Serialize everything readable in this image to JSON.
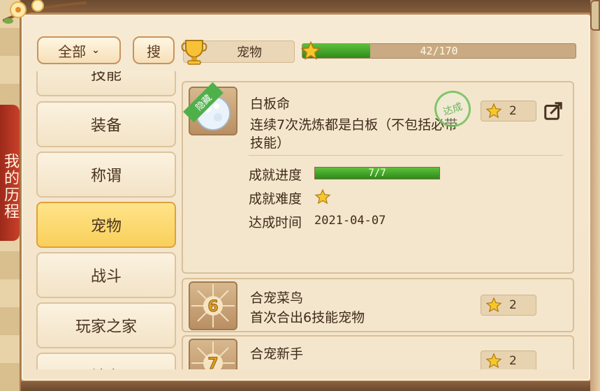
{
  "side_tab": {
    "label": "我的历程"
  },
  "toolbar": {
    "filter_label": "全部",
    "search_label": "搜",
    "category_label": "宠物",
    "progress": {
      "current": 42,
      "total": 170,
      "text": "42/170",
      "fraction": 0.247
    }
  },
  "categories": [
    {
      "label": "技能",
      "active": false
    },
    {
      "label": "装备",
      "active": false
    },
    {
      "label": "称谓",
      "active": false
    },
    {
      "label": "宠物",
      "active": true
    },
    {
      "label": "战斗",
      "active": false
    },
    {
      "label": "玩家之家",
      "active": false
    },
    {
      "label": "社交",
      "active": false
    }
  ],
  "achievements": [
    {
      "ribbon": "隐藏",
      "name": "白板命",
      "desc_line1": "连续7次洗炼都是白板（不包括必带",
      "desc_line2": "技能）",
      "points": "2",
      "stamp": "达成",
      "details": {
        "progress_label": "成就进度",
        "progress_text": "7/7",
        "progress_fraction": 1.0,
        "difficulty_label": "成就难度",
        "difficulty_stars": 1,
        "time_label": "达成时间",
        "time_value": "2021-04-07"
      }
    },
    {
      "icon_num": "6",
      "name": "合宠菜鸟",
      "desc": "首次合出6技能宠物",
      "points": "2"
    },
    {
      "icon_num": "7",
      "name": "合宠新手",
      "points": "2"
    }
  ],
  "colors": {
    "accent_gold": "#f9cf5a",
    "progress_green": "#3ea52a",
    "frame_brown": "#b98a5a"
  }
}
